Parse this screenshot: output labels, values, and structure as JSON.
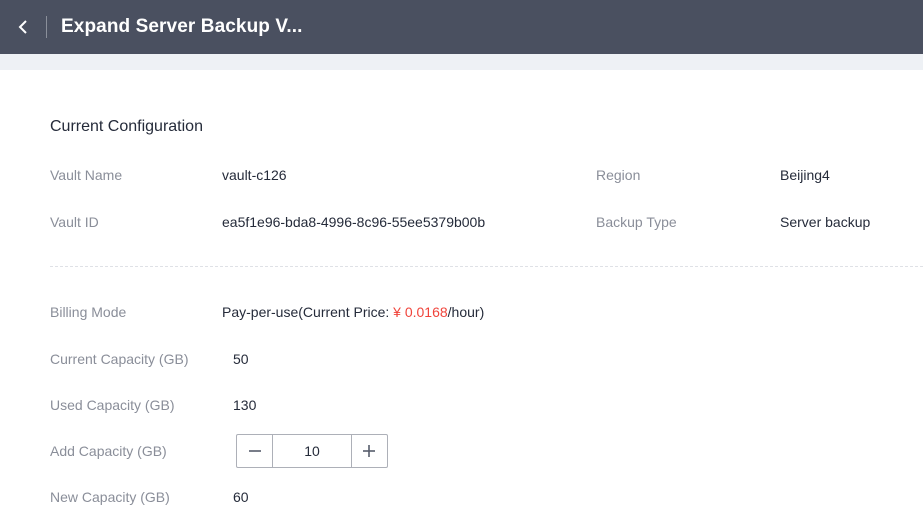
{
  "header": {
    "title": "Expand Server Backup V..."
  },
  "config": {
    "section_title": "Current Configuration",
    "vault_name_label": "Vault Name",
    "vault_name_value": "vault-c126",
    "region_label": "Region",
    "region_value": "Beijing4",
    "vault_id_label": "Vault ID",
    "vault_id_value": "ea5f1e96-bda8-4996-8c96-55ee5379b00b",
    "backup_type_label": "Backup Type",
    "backup_type_value": "Server backup"
  },
  "billing": {
    "billing_mode_label": "Billing Mode",
    "billing_mode_prefix": "Pay-per-use(Current Price: ",
    "billing_price": "¥ 0.0168",
    "billing_suffix": "/hour)",
    "current_capacity_label": "Current Capacity (GB)",
    "current_capacity_value": "50",
    "used_capacity_label": "Used Capacity (GB)",
    "used_capacity_value": "130",
    "add_capacity_label": "Add Capacity (GB)",
    "add_capacity_value": "10",
    "new_capacity_label": "New Capacity (GB)",
    "new_capacity_value": "60"
  },
  "icons": {
    "back": "chevron-left-icon",
    "minus": "minus-icon",
    "plus": "plus-icon"
  },
  "colors": {
    "header_bg": "#4a5060",
    "price": "#f0443b",
    "label": "#8a8e99",
    "text": "#252b3a"
  }
}
